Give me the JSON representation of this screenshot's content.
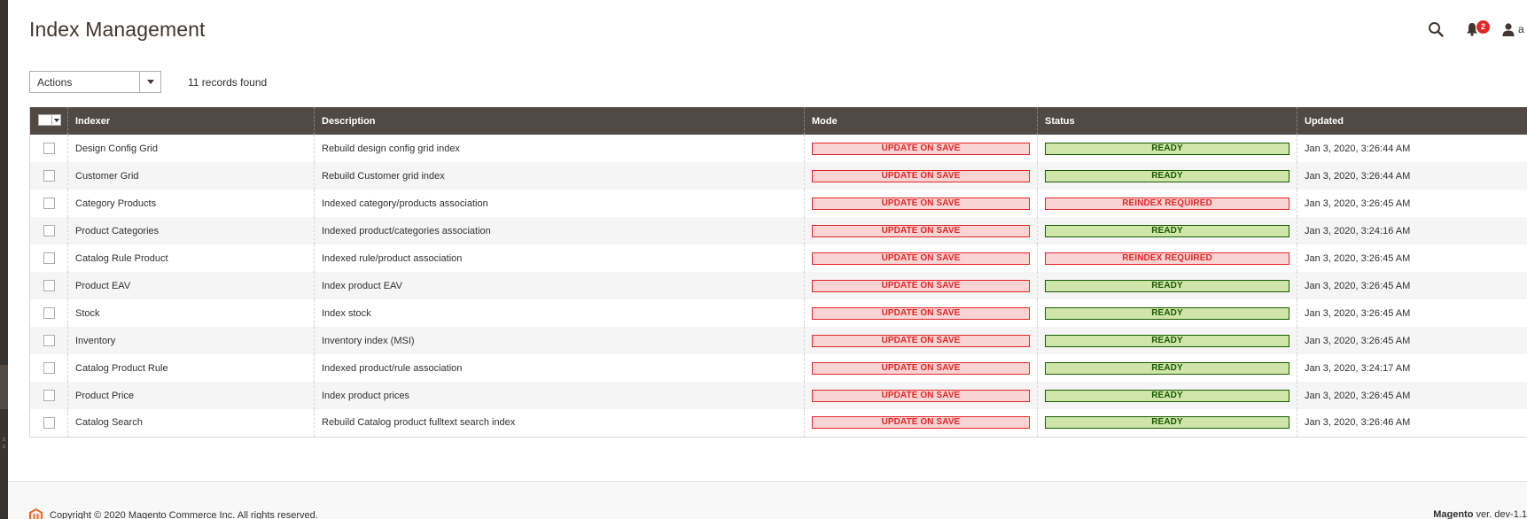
{
  "header": {
    "title": "Index Management",
    "notification_count": "2",
    "user_initial": "a"
  },
  "toolbar": {
    "actions_label": "Actions",
    "records_found": "11 records found"
  },
  "grid": {
    "columns": {
      "indexer": "Indexer",
      "description": "Description",
      "mode": "Mode",
      "status": "Status",
      "updated": "Updated"
    },
    "rows": [
      {
        "indexer": "Design Config Grid",
        "description": "Rebuild design config grid index",
        "mode": "UPDATE ON SAVE",
        "status": "READY",
        "status_type": "ready",
        "updated": "Jan 3, 2020, 3:26:44 AM"
      },
      {
        "indexer": "Customer Grid",
        "description": "Rebuild Customer grid index",
        "mode": "UPDATE ON SAVE",
        "status": "READY",
        "status_type": "ready",
        "updated": "Jan 3, 2020, 3:26:44 AM"
      },
      {
        "indexer": "Category Products",
        "description": "Indexed category/products association",
        "mode": "UPDATE ON SAVE",
        "status": "REINDEX REQUIRED",
        "status_type": "reindex",
        "updated": "Jan 3, 2020, 3:26:45 AM"
      },
      {
        "indexer": "Product Categories",
        "description": "Indexed product/categories association",
        "mode": "UPDATE ON SAVE",
        "status": "READY",
        "status_type": "ready",
        "updated": "Jan 3, 2020, 3:24:16 AM"
      },
      {
        "indexer": "Catalog Rule Product",
        "description": "Indexed rule/product association",
        "mode": "UPDATE ON SAVE",
        "status": "REINDEX REQUIRED",
        "status_type": "reindex",
        "updated": "Jan 3, 2020, 3:26:45 AM"
      },
      {
        "indexer": "Product EAV",
        "description": "Index product EAV",
        "mode": "UPDATE ON SAVE",
        "status": "READY",
        "status_type": "ready",
        "updated": "Jan 3, 2020, 3:26:45 AM"
      },
      {
        "indexer": "Stock",
        "description": "Index stock",
        "mode": "UPDATE ON SAVE",
        "status": "READY",
        "status_type": "ready",
        "updated": "Jan 3, 2020, 3:26:45 AM"
      },
      {
        "indexer": "Inventory",
        "description": "Inventory index (MSI)",
        "mode": "UPDATE ON SAVE",
        "status": "READY",
        "status_type": "ready",
        "updated": "Jan 3, 2020, 3:26:45 AM"
      },
      {
        "indexer": "Catalog Product Rule",
        "description": "Indexed product/rule association",
        "mode": "UPDATE ON SAVE",
        "status": "READY",
        "status_type": "ready",
        "updated": "Jan 3, 2020, 3:24:17 AM"
      },
      {
        "indexer": "Product Price",
        "description": "Index product prices",
        "mode": "UPDATE ON SAVE",
        "status": "READY",
        "status_type": "ready",
        "updated": "Jan 3, 2020, 3:26:45 AM"
      },
      {
        "indexer": "Catalog Search",
        "description": "Rebuild Catalog product fulltext search index",
        "mode": "UPDATE ON SAVE",
        "status": "READY",
        "status_type": "ready",
        "updated": "Jan 3, 2020, 3:26:46 AM"
      }
    ]
  },
  "footer": {
    "copyright": "Copyright © 2020 Magento Commerce Inc. All rights reserved.",
    "brand": "Magento",
    "version": " ver. dev-1.1"
  },
  "side_strip_glyph": "s\ns",
  "colors": {
    "header_bg": "#514943",
    "ready": "#185b00",
    "reindex": "#e22626",
    "badge": "#e22626",
    "logo": "#f26322"
  },
  "icons": [
    "search-icon",
    "bell-icon",
    "user-icon",
    "magento-logo-icon",
    "chevron-down-icon"
  ]
}
